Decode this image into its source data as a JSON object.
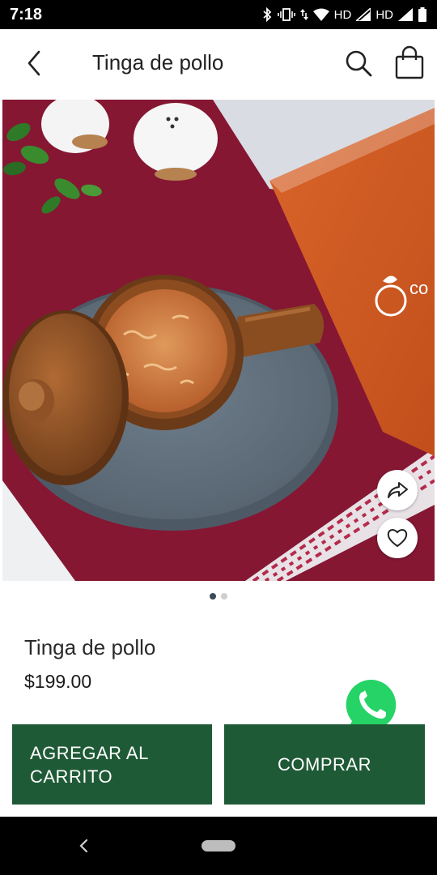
{
  "status_bar": {
    "time": "7:18",
    "network_label_1": "HD",
    "network_label_2": "HD",
    "icons": [
      "bluetooth-icon",
      "vibrate-icon",
      "data-arrows-icon",
      "wifi-icon",
      "signal-icon",
      "signal-icon",
      "battery-icon"
    ]
  },
  "header": {
    "title": "Tinga de pollo",
    "back_icon": "chevron-left-icon",
    "search_icon": "search-icon",
    "cart_icon": "shopping-bag-icon"
  },
  "gallery": {
    "image_alt": "product-photo",
    "page_count": 2,
    "active_index": 0,
    "share_icon": "share-icon",
    "favorite_icon": "heart-icon",
    "package_logo_text": "co"
  },
  "product": {
    "name": "Tinga de pollo",
    "price": "$199.00"
  },
  "whatsapp": {
    "icon": "whatsapp-icon"
  },
  "actions": {
    "add_to_cart_label": "AGREGAR AL\nCARRITO",
    "buy_label": "COMPRAR"
  },
  "colors": {
    "primary_button": "#1f5a36",
    "whatsapp_green": "#25d366",
    "active_dot": "#3b4a55"
  }
}
